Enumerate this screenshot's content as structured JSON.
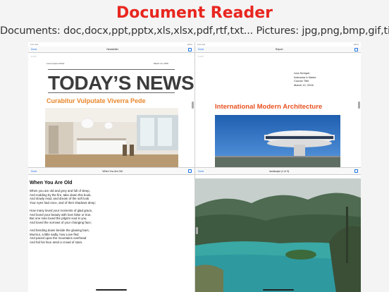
{
  "header": {
    "title": "Document Reader",
    "subtitle": "Documents: doc,docx,ppt,pptx,xls,xlsx,pdf,rtf,txt...   Pictures: jpg,png,bmp,gif,tiff"
  },
  "panes": [
    {
      "nav_title": "Newsletter",
      "done": "Done",
      "page_count": "1 of 2",
      "company": "Lorem Ipsum Dolor",
      "date": "March 12, 2016",
      "headline": "TODAY’S NEWS",
      "subheadline": "Curabitur Vulputate Viverra Pede"
    },
    {
      "nav_title": "Report",
      "done": "Done",
      "page_count": "1 of 2",
      "address_lines": [
        "Lina Semper",
        "Instructor’s Name",
        "Course Title",
        "March 12, 2016"
      ],
      "headline": "International Modern Architecture"
    },
    {
      "nav_title": "When You Are Old",
      "done": "Done",
      "poem_title": "When You Are Old",
      "poem": "When you are old and grey and full of sleep,\nAnd nodding by the fire, take down this book,\nAnd slowly read, and dream of the soft look\nYour eyes had once, and of their shadows deep;\n\nHow many loved your moments of glad grace,\nAnd loved your beauty with love false or true,\nBut one man loved the pilgrim soul in you,\nAnd loved the sorrows of your changing face;\n\nAnd bending down beside the glowing bars,\nMurmur, a little sadly, how Love fled\nAnd paced upon the mountains overhead\nAnd hid his face amid a crowd of stars."
    },
    {
      "nav_title": "landscape (1 of 3)",
      "done": "Done"
    }
  ]
}
